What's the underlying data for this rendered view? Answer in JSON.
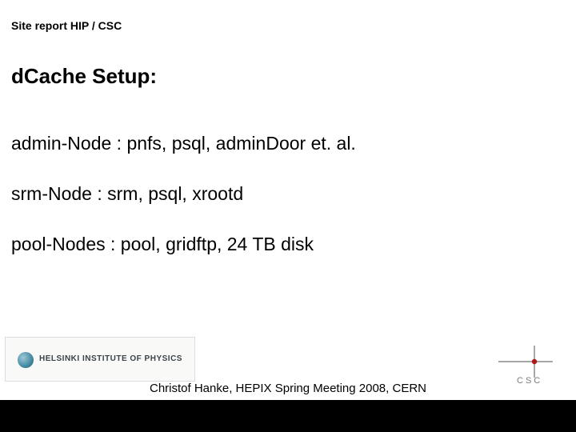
{
  "header": "Site report HIP / CSC",
  "title": "dCache Setup:",
  "lines": [
    "admin-Node : pnfs, psql, adminDoor et. al.",
    "srm-Node : srm, psql, xrootd",
    "pool-Nodes : pool, gridftp, 24 TB disk"
  ],
  "hip_logo_text": "HELSINKI INSTITUTE OF PHYSICS",
  "csc_logo_text": "CSC",
  "footer": "Christof Hanke,  HEPIX Spring Meeting 2008, CERN"
}
